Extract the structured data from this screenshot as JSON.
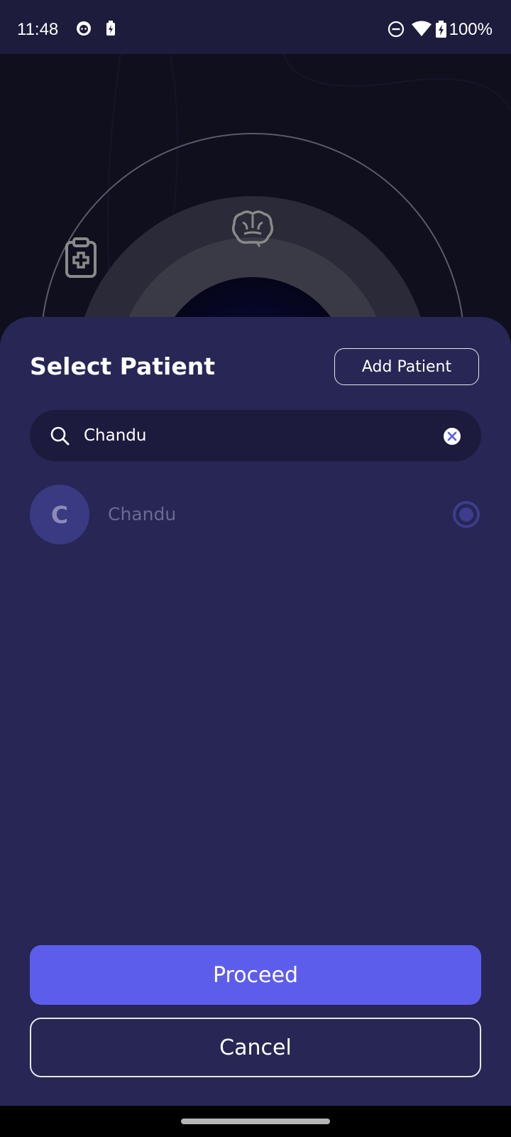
{
  "status_bar": {
    "time": "11:48",
    "battery_percent": "100%",
    "icons": [
      "notification-app-icon",
      "battery-saver-icon",
      "do-not-disturb-icon",
      "wifi-icon",
      "battery-charging-icon"
    ]
  },
  "background": {
    "icons": [
      "clipboard-medical-icon",
      "brain-icon"
    ]
  },
  "sheet": {
    "title": "Select Patient",
    "add_patient_label": "Add Patient",
    "search": {
      "value": "Chandu",
      "icon": "search-icon",
      "clear_icon": "clear-icon"
    },
    "patients": [
      {
        "initial": "C",
        "name": "Chandu",
        "selected": true
      }
    ],
    "proceed_label": "Proceed",
    "cancel_label": "Cancel"
  },
  "colors": {
    "sheet_background": "#272654",
    "accent": "#5d5dec",
    "search_background": "#1c1b3e",
    "status_bar": "#1d1c3d"
  }
}
